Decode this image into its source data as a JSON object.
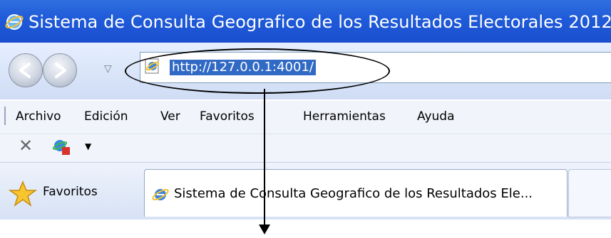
{
  "window": {
    "title": "Sistema de Consulta Geografico de los Resultados Electorales 2012"
  },
  "address_bar": {
    "url": "http://127.0.0.1:4001/"
  },
  "menu": {
    "items": [
      "Archivo",
      "Edición",
      "Ver",
      "Favoritos",
      "Herramientas",
      "Ayuda"
    ]
  },
  "favorites_bar": {
    "favorites_label": "Favoritos"
  },
  "tab": {
    "label": "Sistema de Consulta Geografico de los Resultados Ele..."
  },
  "icons": {
    "title": "ie-logo-icon",
    "address": "ie-page-icon",
    "toolbar": "web-slice-icon",
    "favorites": "star-icon",
    "tab": "ie-logo-icon"
  },
  "colors": {
    "titlebar": "#1f5ad8",
    "url_highlight": "#316ac5"
  }
}
